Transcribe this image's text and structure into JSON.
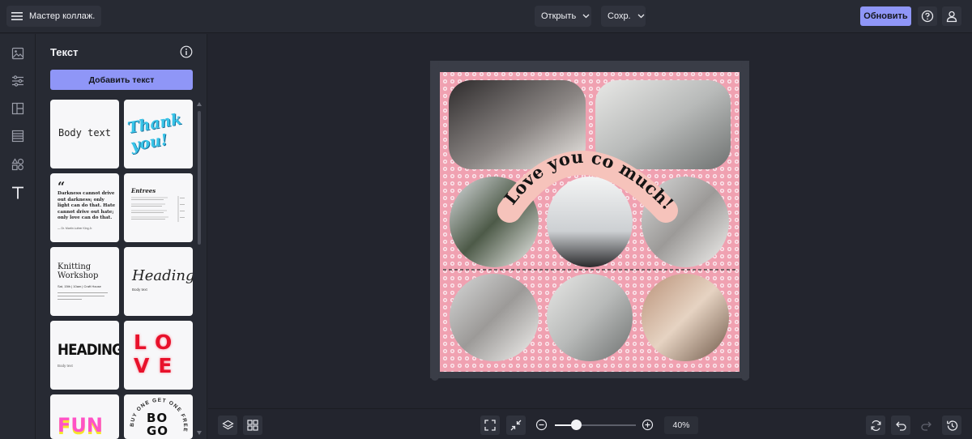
{
  "topbar": {
    "menu_label": "Мастер коллаж.",
    "open_label": "Открыть",
    "save_label": "Сохр.",
    "update_label": "Обновить"
  },
  "panel": {
    "title": "Текст",
    "add_text_label": "Добавить текст",
    "templates": [
      {
        "text": "Body text"
      },
      {
        "text": "Thank you!"
      },
      {
        "quote": "Darkness cannot drive out darkness; only light can do that. Hate cannot drive out hate; only love can do that.",
        "author": "— Dr. Martin Luther King Jr."
      },
      {
        "title": "Entrees"
      },
      {
        "title": "Knitting Workshop",
        "subtitle": "Sat, 15th | 10am | Craft House"
      },
      {
        "title": "Heading",
        "subtitle": "Body text"
      },
      {
        "title": "HEADING",
        "subtitle": "Body text"
      },
      {
        "title": "LOVE"
      },
      {
        "title": "FUN"
      },
      {
        "title": "BOGO",
        "ring": "BUY ONE GET ONE FREE"
      }
    ]
  },
  "canvas": {
    "arc_text": "Love you co much!!!",
    "zoom": "40%"
  },
  "colors": {
    "accent": "#8f96f7",
    "collage_bg": "#f2a6b4",
    "background": "#23252e"
  }
}
